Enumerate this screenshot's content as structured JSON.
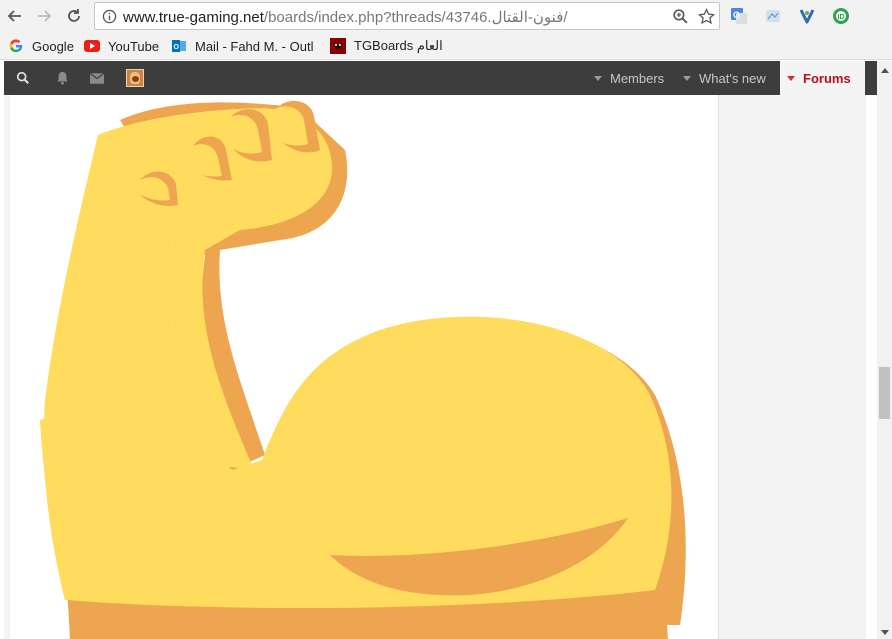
{
  "browser": {
    "url_host": "www.true-gaming.net",
    "url_path": "/boards/index.php?threads/فنون-القتال.43746/"
  },
  "bookmarks": [
    {
      "label": "Google",
      "icon": "google-icon"
    },
    {
      "label": "YouTube",
      "icon": "youtube-icon"
    },
    {
      "label": "Mail - Fahd M. - Outl",
      "icon": "outlook-icon"
    },
    {
      "label": "TGBoards العام",
      "icon": "tgboards-icon"
    }
  ],
  "forum_nav": {
    "tabs": [
      {
        "label": "Members"
      },
      {
        "label": "What's new"
      },
      {
        "label": "Forums"
      }
    ],
    "active_tab": "Forums",
    "colors": {
      "bar": "#3d3d3d",
      "active_text": "#b3121a"
    }
  },
  "content": {
    "image_icon": "flexed-biceps-emoji",
    "colors": {
      "skin": "#ffdc5d",
      "shade": "#eda54f"
    }
  }
}
